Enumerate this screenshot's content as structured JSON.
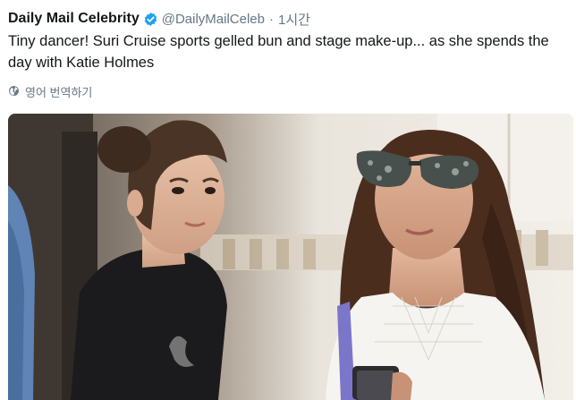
{
  "tweet": {
    "display_name": "Daily Mail Celebrity",
    "handle": "@DailyMailCeleb",
    "separator": "·",
    "timestamp": "1시간",
    "text": "Tiny dancer! Suri Cruise sports gelled bun and stage make-up... as she spends the day with Katie Holmes",
    "translate_label": "영어 번역하기",
    "verified_icon": "verified-badge-icon",
    "globe_icon": "globe-icon"
  },
  "colors": {
    "text": "#14171a",
    "secondary": "#657786",
    "verified": "#1da1f2"
  }
}
